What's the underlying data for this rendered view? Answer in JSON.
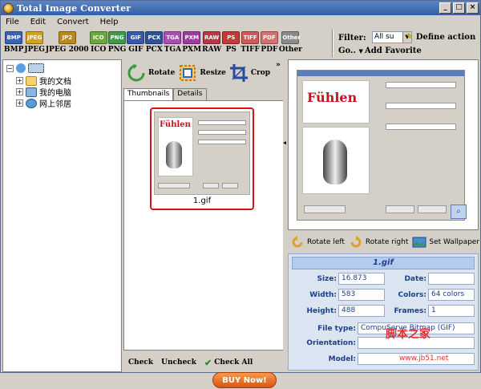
{
  "window": {
    "title": "Total Image Converter"
  },
  "menu": [
    {
      "label": "File",
      "key": "F"
    },
    {
      "label": "Edit",
      "key": "E"
    },
    {
      "label": "Convert",
      "key": "C"
    },
    {
      "label": "Help",
      "key": "H"
    }
  ],
  "formats": [
    {
      "label": "BMP",
      "tag": "BMP",
      "color": "#3a62b8"
    },
    {
      "label": "JPEG",
      "tag": "JPEG",
      "color": "#d8a21c"
    },
    {
      "label": "JPEG 2000",
      "tag": "JP2",
      "color": "#c08818"
    },
    {
      "label": "ICO",
      "tag": "ICO",
      "color": "#6aa83a"
    },
    {
      "label": "PNG",
      "tag": "PNG",
      "color": "#3c9a4a"
    },
    {
      "label": "GIF",
      "tag": "GIF",
      "color": "#3a56b0"
    },
    {
      "label": "PCX",
      "tag": "PCX",
      "color": "#2f4fa0"
    },
    {
      "label": "TGA",
      "tag": "TGA",
      "color": "#b04ab6"
    },
    {
      "label": "PXM",
      "tag": "PXM",
      "color": "#a03aa8"
    },
    {
      "label": "RAW",
      "tag": "RAW",
      "color": "#b83848"
    },
    {
      "label": "PS",
      "tag": "PS",
      "color": "#c83838"
    },
    {
      "label": "TIFF",
      "tag": "TIFF",
      "color": "#d05a5a"
    },
    {
      "label": "PDF",
      "tag": "PDF",
      "color": "#d87070"
    },
    {
      "label": "Other",
      "tag": "Other",
      "color": "#8a8a8a"
    }
  ],
  "filter": {
    "label": "Filter:",
    "value": "All su",
    "define_action": "Define action"
  },
  "goto": {
    "label": "Go..",
    "add_favorite": "Add Favorite"
  },
  "tree": [
    {
      "label": "我的文档"
    },
    {
      "label": "我的电脑"
    },
    {
      "label": "网上邻居"
    }
  ],
  "actions": {
    "rotate": "Rotate",
    "resize": "Resize",
    "crop": "Crop"
  },
  "tabs": [
    "Thumbnails",
    "Details"
  ],
  "thumbnail": {
    "name": "1.gif",
    "brand": "Fühlen"
  },
  "buy_now": "BUY Now!",
  "checkbar": {
    "check": "Check",
    "uncheck": "Uncheck",
    "check_all": "Check All"
  },
  "preview": {
    "brand": "Fühlen"
  },
  "rotate": {
    "left": "Rotate left",
    "right": "Rotate right",
    "wallpaper": "Set Wallpaper"
  },
  "info": {
    "filename": "1.gif",
    "size_label": "Size:",
    "size": "16.873",
    "date_label": "Date:",
    "date": "",
    "width_label": "Width:",
    "width": "583",
    "colors_label": "Colors:",
    "colors": "64 colors",
    "height_label": "Height:",
    "height": "488",
    "frames_label": "Frames:",
    "frames": "1",
    "filetype_label": "File type:",
    "filetype": "CompuServe Bitmap (GIF)",
    "orientation_label": "Orientation:",
    "orientation": "",
    "model_label": "Model:",
    "model": ""
  },
  "watermark": {
    "text": "脚本之家",
    "url": "www.jb51.net"
  }
}
